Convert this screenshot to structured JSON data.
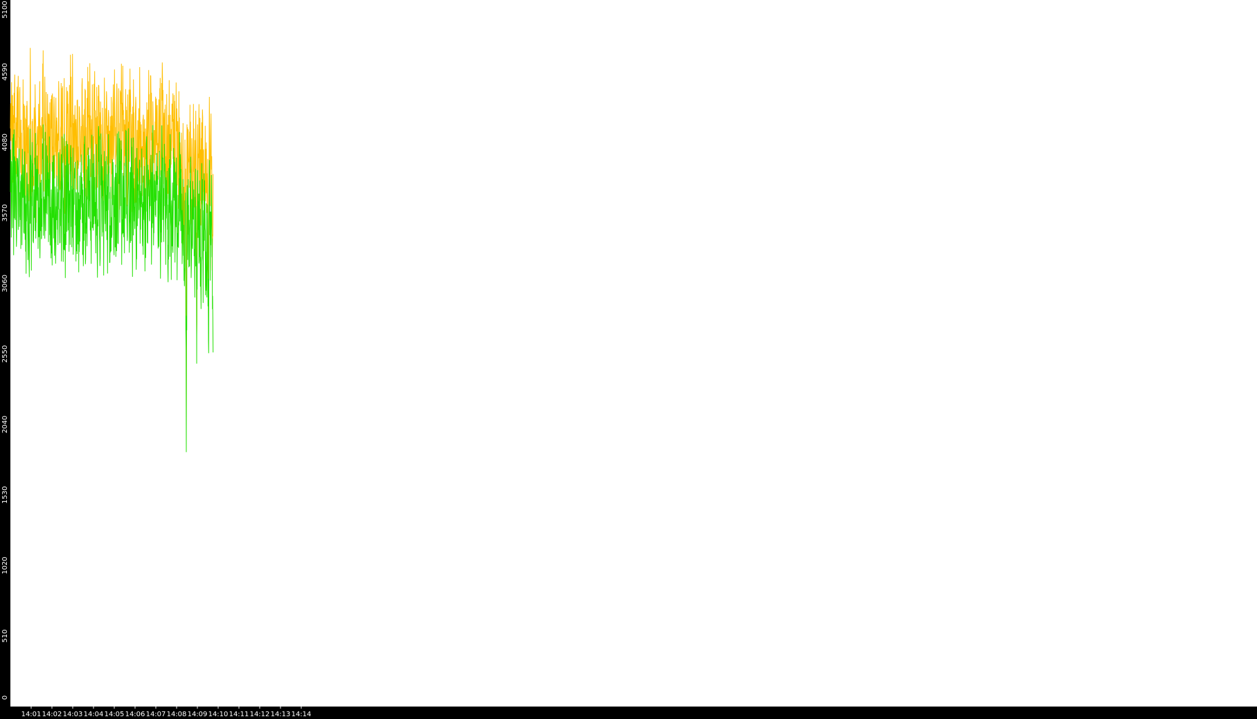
{
  "chart_data": {
    "type": "line",
    "title": "",
    "xlabel": "",
    "ylabel": "",
    "ylim": [
      0,
      5100
    ],
    "yticks": [
      "0",
      "510",
      "1020",
      "1530",
      "2040",
      "2550",
      "3060",
      "3570",
      "4080",
      "4590",
      "5100"
    ],
    "xlim_minutes": [
      14.0,
      15.0
    ],
    "xticks": [
      "14:01",
      "14:02",
      "14:03",
      "14:04",
      "14:05",
      "14:06",
      "14:07",
      "14:08",
      "14:09",
      "14:10",
      "14:11",
      "14:12",
      "14:13",
      "14:14"
    ],
    "grid": false,
    "legend": "none",
    "background": "#ffffff",
    "axis_color": "#000000",
    "series": [
      {
        "color": "#ffbe00",
        "sample_seconds": 2,
        "values": [
          4180,
          4310,
          3950,
          4420,
          3790,
          4080,
          4510,
          3900,
          4260,
          3820,
          4350,
          4470,
          4120,
          3980,
          4230,
          3860,
          4150,
          3750,
          4020,
          4290,
          3810,
          4110,
          3690,
          4060,
          4380,
          3940,
          4170,
          3730,
          4210,
          4440,
          3880,
          4000,
          4250,
          3800,
          4130,
          3920,
          4320,
          3860,
          4070,
          4190,
          3770,
          4040,
          4280,
          3910,
          4160,
          3850,
          4220,
          4470,
          3960,
          4090,
          4300,
          3880,
          4140,
          3990,
          4240,
          3830,
          4100,
          4370,
          3940,
          4180,
          3870,
          4230,
          4050,
          4410,
          3820,
          4120,
          3980,
          4260,
          3900,
          4150,
          4460,
          3930,
          4030,
          4200,
          3860,
          4340,
          3970,
          4110,
          4240,
          3890,
          4090,
          4480,
          4170,
          4290,
          3950,
          4140,
          4060,
          4520,
          3920,
          4180,
          4350,
          3840,
          4070,
          4250,
          3930,
          4160,
          4020,
          4390,
          3890,
          4110,
          4270,
          3980,
          4150,
          4050,
          4210,
          3860,
          4080,
          4320,
          3950,
          4190,
          3870,
          4130,
          4260,
          3990,
          4090,
          4400,
          3830,
          4170,
          4240,
          3910,
          4020,
          4310,
          4130,
          3880,
          4260,
          4040,
          3920,
          4180,
          4380,
          3820,
          4100,
          4210,
          3970,
          4330,
          3890,
          4050,
          4250,
          3940,
          4140,
          4420,
          3870,
          4030,
          4290,
          4160,
          3930,
          4200,
          3850,
          4080,
          4360,
          3990,
          4140,
          4270,
          3900,
          4030,
          4450,
          3810,
          4120,
          4220,
          3950,
          4060,
          4390,
          3880,
          4160,
          4280,
          3920,
          4100,
          3980,
          4340,
          4070,
          3860,
          4230,
          4150,
          3940,
          4300,
          4010,
          4190,
          3870,
          4110,
          4260,
          3960,
          4040,
          4410,
          3830,
          4170,
          4240,
          3980,
          4090,
          4330,
          3900,
          4210,
          4050,
          3790,
          4280,
          4120,
          3940,
          4180,
          4020,
          4370,
          3870,
          4130,
          4250,
          3960,
          4060,
          4430,
          3820,
          4150,
          4290,
          3930,
          4090,
          4230,
          3990,
          4100,
          4350,
          3880,
          4170,
          4010,
          4270,
          3850,
          4110,
          4440,
          3970,
          4190,
          4060,
          4320,
          3910,
          3980,
          4210,
          4070,
          3800,
          4160,
          4030,
          4280,
          3920,
          4100,
          4230,
          3960,
          4120,
          4380,
          3860,
          4050,
          4200,
          3770,
          4140,
          3950,
          4260,
          4080,
          3890,
          4150,
          3320,
          4020,
          3700,
          3610,
          4100,
          3890,
          2020,
          4210,
          3670,
          4050,
          3960,
          3860,
          4230,
          3540,
          4110,
          3750,
          3980,
          4180,
          3610,
          3890,
          4060,
          2690,
          4010,
          3830,
          4150,
          3720,
          4040,
          3480,
          3950,
          4120,
          3660,
          4030,
          3810,
          3900,
          3730,
          4080,
          3570,
          3960,
          2810,
          4100,
          3850,
          4020,
          3980,
          3690,
          3410
        ]
      },
      {
        "color": "#22e000",
        "sample_seconds": 2,
        "values": [
          3720,
          3580,
          3900,
          3460,
          3810,
          3650,
          3980,
          3520,
          3760,
          3390,
          3870,
          3600,
          3940,
          3470,
          3720,
          3310,
          3800,
          3560,
          3680,
          3920,
          3420,
          3750,
          3290,
          3640,
          3860,
          3510,
          3780,
          3200,
          3700,
          3990,
          3450,
          3620,
          3830,
          3370,
          3740,
          3540,
          3910,
          3480,
          3660,
          3780,
          3310,
          3610,
          3850,
          3430,
          3720,
          3390,
          3810,
          3960,
          3510,
          3670,
          3880,
          3440,
          3750,
          3560,
          3820,
          3360,
          3690,
          3930,
          3490,
          3740,
          3410,
          3800,
          3610,
          3990,
          3350,
          3680,
          3530,
          3840,
          3450,
          3720,
          4010,
          3480,
          3600,
          3780,
          3390,
          3900,
          3520,
          3680,
          3810,
          3420,
          3650,
          4030,
          3730,
          3860,
          3500,
          3710,
          3620,
          4060,
          3470,
          3740,
          3910,
          3380,
          3630,
          3820,
          3480,
          3720,
          3590,
          3950,
          3430,
          3670,
          3840,
          3530,
          3710,
          3610,
          3780,
          3400,
          3640,
          3880,
          3500,
          3750,
          3420,
          3690,
          3830,
          3540,
          3660,
          3960,
          3370,
          3730,
          3800,
          3460,
          3580,
          3870,
          3690,
          3420,
          3820,
          3600,
          3470,
          3740,
          3940,
          3360,
          3660,
          3770,
          3520,
          3890,
          3430,
          3610,
          3810,
          3490,
          3700,
          3980,
          3410,
          3590,
          3850,
          3720,
          3480,
          3760,
          3390,
          3640,
          3920,
          3540,
          3700,
          3830,
          3450,
          3590,
          4010,
          3350,
          3680,
          3780,
          3500,
          3620,
          3950,
          3420,
          3720,
          3840,
          3470,
          3660,
          3530,
          3900,
          3630,
          3400,
          3790,
          3710,
          3490,
          3860,
          3570,
          3750,
          3410,
          3670,
          3820,
          3510,
          3600,
          3970,
          3380,
          3730,
          3800,
          3530,
          3650,
          3890,
          3450,
          3770,
          3610,
          3330,
          3840,
          3680,
          3490,
          3740,
          3580,
          3930,
          3420,
          3690,
          3810,
          3510,
          3620,
          3990,
          3370,
          3710,
          3850,
          3480,
          3650,
          3790,
          3540,
          3660,
          3910,
          3430,
          3730,
          3570,
          3830,
          3400,
          3670,
          4000,
          3520,
          3750,
          3620,
          3880,
          3460,
          3530,
          3770,
          3630,
          3340,
          3720,
          3590,
          3840,
          3470,
          3660,
          3790,
          3510,
          3680,
          3940,
          3410,
          3610,
          3760,
          3320,
          3700,
          3500,
          3820,
          3640,
          3440,
          3710,
          3200,
          3580,
          3260,
          3170,
          3660,
          3450,
          1840,
          3770,
          3230,
          3610,
          3520,
          3420,
          3790,
          3100,
          3670,
          3310,
          3540,
          3740,
          3170,
          3450,
          3620,
          2480,
          3570,
          3390,
          3710,
          3280,
          3600,
          3040,
          3510,
          3680,
          3220,
          3590,
          3370,
          3460,
          3290,
          3640,
          3130,
          3520,
          2650,
          3660,
          3410,
          3580,
          3540,
          3250,
          2970
        ]
      }
    ]
  }
}
